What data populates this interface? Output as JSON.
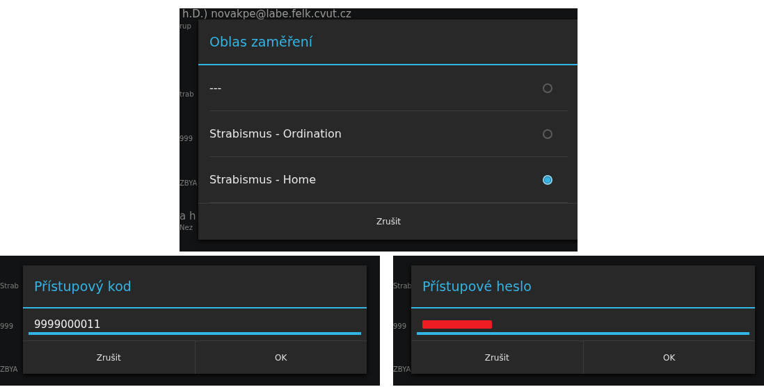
{
  "panels": [
    {
      "kind": "choice",
      "background": {
        "top": "h.D.) novakpe@labe.felk.cvut.cz",
        "side": [
          "rup",
          "trab",
          "999",
          "ZBYA",
          "a h",
          "Nez"
        ]
      },
      "dialog": {
        "title": "Oblas zaměření",
        "options": [
          {
            "label": "---",
            "selected": false
          },
          {
            "label": "Strabismus - Ordination",
            "selected": false
          },
          {
            "label": "Strabismus - Home",
            "selected": true
          }
        ],
        "buttons": [
          "Zrušit"
        ]
      }
    },
    {
      "kind": "input",
      "background": {
        "side": [
          "Strab",
          "999",
          "ZBYA"
        ]
      },
      "dialog": {
        "title": "Přístupový kod",
        "value": "9999000011",
        "redacted": false,
        "buttons": [
          "Zrušit",
          "OK"
        ]
      }
    },
    {
      "kind": "input",
      "background": {
        "side": [
          "Strab",
          "999",
          "ZBYA"
        ]
      },
      "dialog": {
        "title": "Přístupové heslo",
        "redacted": true,
        "buttons": [
          "Zrušit",
          "OK"
        ]
      }
    }
  ]
}
